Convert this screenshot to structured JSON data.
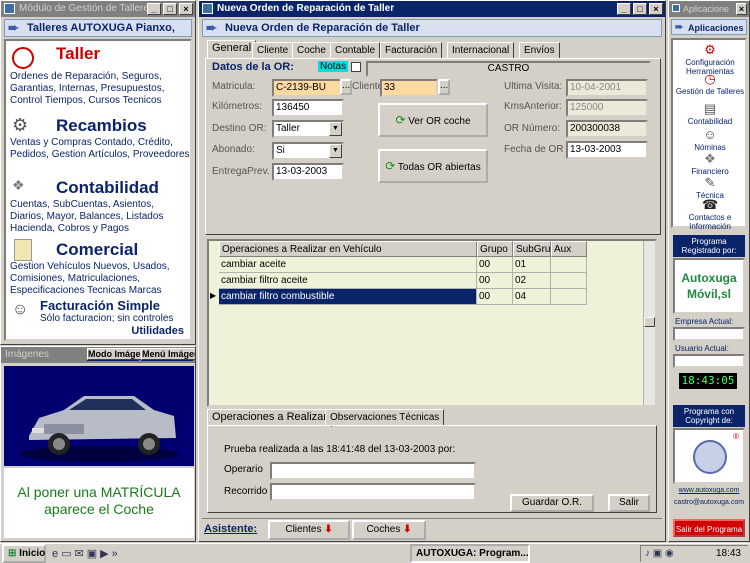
{
  "left_window": {
    "title": "Módulo de Gestión de Talleres",
    "header": "Talleres AUTOXUGA Pianxo,",
    "sections": [
      {
        "name": "Taller",
        "text": "Ordenes de Reparación, Seguros, Garantias, Internas, Presupuestos, Control Tiempos, Cursos Tecnicos"
      },
      {
        "name": "Recambios",
        "text": "Ventas y Compras Contado, Crédito, Pedidos, Gestion Artículos, Proveedores"
      },
      {
        "name": "Contabilidad",
        "text": "Cuentas, SubCuentas, Asientos, Diarios, Mayor, Balances, Listados Hacienda, Cobros y Pagos"
      },
      {
        "name": "Comercial",
        "text": "Gestion Vehículos Nuevos, Usados, Comisiones, Matriculaciones, Especificaciones Tecnicas Marcas"
      },
      {
        "name": "Facturación Simple",
        "text": "Sólo facturacion; sin controles"
      }
    ],
    "utilidades": "Utilidades"
  },
  "images_window": {
    "title": "Imágenes",
    "mode_button": "Modo Imágen",
    "menu_button": "Menú Imágen",
    "caption": "Al poner una MATRÍCULA aparece el Coche"
  },
  "main_window": {
    "title": "Nueva Orden de Reparación de Taller",
    "header": "Nueva Orden de Reparación de Taller",
    "tabs": [
      "General",
      "Cliente",
      "Coche",
      "Contable",
      "Facturación",
      "Internacional",
      "Envíos"
    ],
    "datos_label": "Datos de la OR:",
    "notas_label": "Notas",
    "customer_name": "CASTRO",
    "fields": {
      "matricula_label": "Matricula:",
      "matricula": "C-2139-BU",
      "cliente_label": "Cliente",
      "cliente": "33",
      "ultima_visita_label": "Ultima Visita:",
      "ultima_visita": "10-04-2001",
      "km_label": "Kilómetros:",
      "km": "136450",
      "kms_anterior_label": "KmsAnterior:",
      "kms_anterior": "125000",
      "destino_label": "Destino OR:",
      "destino": "Taller",
      "or_numero_label": "OR Número:",
      "or_numero": "200300038",
      "abonado_label": "Abonado:",
      "abonado": "Si",
      "fecha_or_label": "Fecha de OR",
      "fecha_or": "13-03-2003",
      "entrega_label": "EntregaPrev.",
      "entrega": "13-03-2003"
    },
    "ver_or_button": "Ver OR coche",
    "todas_or_button": "Todas OR abiertas",
    "grid": {
      "columns": [
        "Operaciones a Realizar en Vehículo",
        "Grupo",
        "SubGru",
        "Aux"
      ],
      "rows": [
        [
          "cambiar aceite",
          "00",
          "01",
          ""
        ],
        [
          "cambiar filtro aceite",
          "00",
          "02",
          ""
        ],
        [
          "cambiar filtro combustible",
          "00",
          "04",
          ""
        ]
      ]
    },
    "bottom_tabs": [
      "Operaciones a Realizar",
      "Observaciones Técnicas"
    ],
    "prueba_text": "Prueba realizada a las 18:41:48 del 13-03-2003 por:",
    "operario_label": "Operario",
    "recorrido_label": "Recorrido",
    "guardar_button": "Guardar O.R.",
    "salir_button": "Salir",
    "asistente_label": "Asistente:",
    "clientes_button": "Clientes",
    "coches_button": "Coches"
  },
  "right_window": {
    "title": "Aplicacione",
    "header": "Aplicaciones",
    "items": [
      "Configuración Herramientas",
      "Gestión de Talleres",
      "Contabilidad",
      "Nóminas",
      "Financiero",
      "Técnica",
      "Contactos e Información"
    ],
    "registrado_label": "Programa Registrado por:",
    "brand_line1": "Autoxuga",
    "brand_line2": "Móvil,sl",
    "empresa_label": "Empresa Actual:",
    "usuario_label": "Usuario Actual:",
    "clock": "18:43:05",
    "copyright_label": "Programa con Copyright de:",
    "url": "www.autoxuga.com",
    "email": "castro@autoxuga.com",
    "salir_programa": "Salir del Programa"
  },
  "taskbar": {
    "start": "Inicio",
    "task": "AUTOXUGA: Program...",
    "time": "18:43"
  },
  "colors": {
    "navy": "#0a246a",
    "selected_row": "#0a246a",
    "brand_green": "#1e8a3e",
    "exit_red": "#d40000"
  }
}
